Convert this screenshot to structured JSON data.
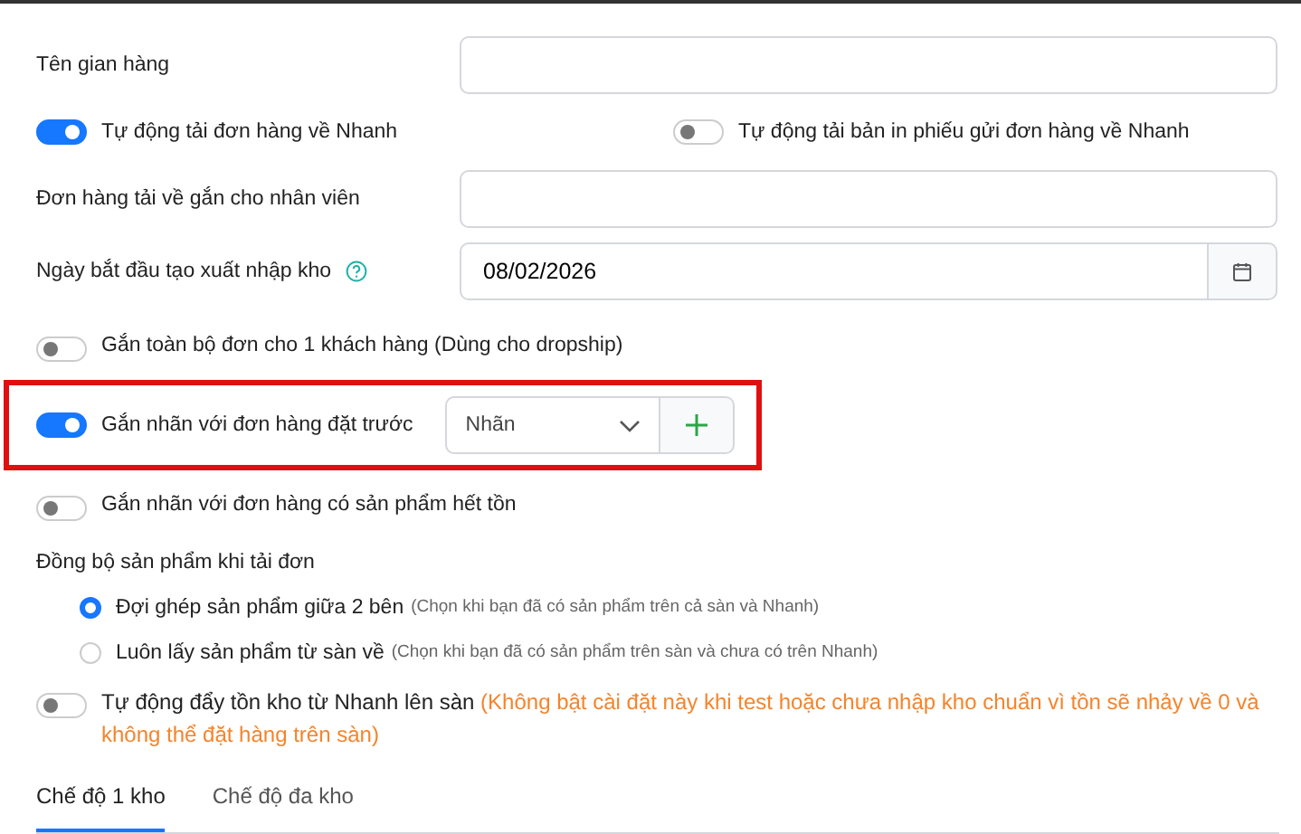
{
  "rows": [
    {
      "kind": "field",
      "label": "Tên gian hàng"
    },
    {
      "kind": "toggles",
      "items": [
        {
          "label": "Tự động tải đơn hàng về Nhanh",
          "on": true
        },
        {
          "label": "Tự động tải bản in phiếu gửi đơn hàng về Nhanh",
          "on": false
        }
      ]
    },
    {
      "kind": "field",
      "label": "Đơn hàng tải về gắn cho nhân viên"
    },
    {
      "kind": "date",
      "label": "Ngày bắt đầu tạo xuất nhập kho",
      "value": "08/02/2026"
    },
    {
      "kind": "toggle",
      "label": "Gắn toàn bộ đơn cho 1 khách hàng (Dùng cho dropship)",
      "on": false
    },
    {
      "kind": "toggle_select",
      "label": "Gắn nhãn với đơn hàng đặt trước",
      "on": true,
      "placeholder": "Nhãn",
      "highlighted": true
    },
    {
      "kind": "toggle",
      "label": "Gắn nhãn với đơn hàng có sản phẩm hết tồn",
      "on": false
    },
    {
      "kind": "radio_group",
      "label": "Đồng bộ sản phẩm khi tải đơn",
      "options": [
        {
          "label": "Đợi ghép sản phẩm giữa 2 bên",
          "hint": "(Chọn khi bạn đã có sản phẩm trên cả sàn và Nhanh)",
          "selected": true
        },
        {
          "label": "Luôn lấy sản phẩm từ sàn về",
          "hint": "(Chọn khi bạn đã có sản phẩm trên sàn và chưa có trên Nhanh)",
          "selected": false
        }
      ]
    },
    {
      "kind": "toggle",
      "label": "Tự động đẩy tồn kho từ Nhanh lên sàn",
      "warning": "(Không bật cài đặt này khi test hoặc chưa nhập kho chuẩn vì tồn sẽ nhảy về 0 và không thể đặt hàng trên sàn)",
      "on": false
    }
  ],
  "tabs": [
    {
      "label": "Chế độ 1 kho",
      "selected": true
    },
    {
      "label": "Chế độ đa kho",
      "selected": false
    }
  ]
}
